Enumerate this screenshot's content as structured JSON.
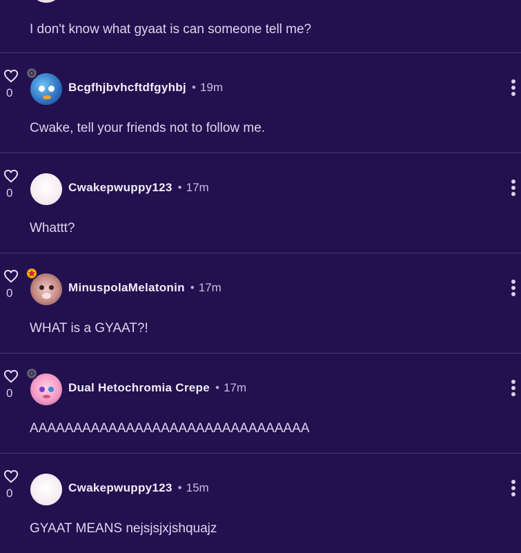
{
  "top_comment": {
    "text": "I don't know what gyaat is can someone tell me?"
  },
  "comments": [
    {
      "username": "Bcgfhjbvhcftdfgyhbj",
      "time": "19m",
      "likes": "0",
      "text": "Cwake, tell your friends not to follow me.",
      "avatar": "blue",
      "badge": "gear"
    },
    {
      "username": "Cwakepwuppy123",
      "time": "17m",
      "likes": "0",
      "text": "Whattt?",
      "avatar": "blank",
      "badge": ""
    },
    {
      "username": "MinuspolaMelatonin",
      "time": "17m",
      "likes": "0",
      "text": "WHAT is a GYAAT?!",
      "avatar": "brown",
      "badge": "star"
    },
    {
      "username": "Dual Hetochromia Crepe",
      "time": "17m",
      "likes": "0",
      "text": "AAAAAAAAAAAAAAAAAAAAAAAAAAAAAAAA",
      "avatar": "pink",
      "badge": "gear"
    },
    {
      "username": "Cwakepwuppy123",
      "time": "15m",
      "likes": "0",
      "text": "GYAAT MEANS nejsjsjxjshquajz",
      "avatar": "blank",
      "badge": ""
    }
  ],
  "separator": "•",
  "icons": {
    "like": "heart-outline-icon",
    "more": "more-vertical-icon",
    "badge_gear": "gear-icon",
    "badge_star": "star-icon"
  },
  "colors": {
    "background": "#22104f",
    "divider": "#4a3a78",
    "text": "#dcd6ef"
  }
}
